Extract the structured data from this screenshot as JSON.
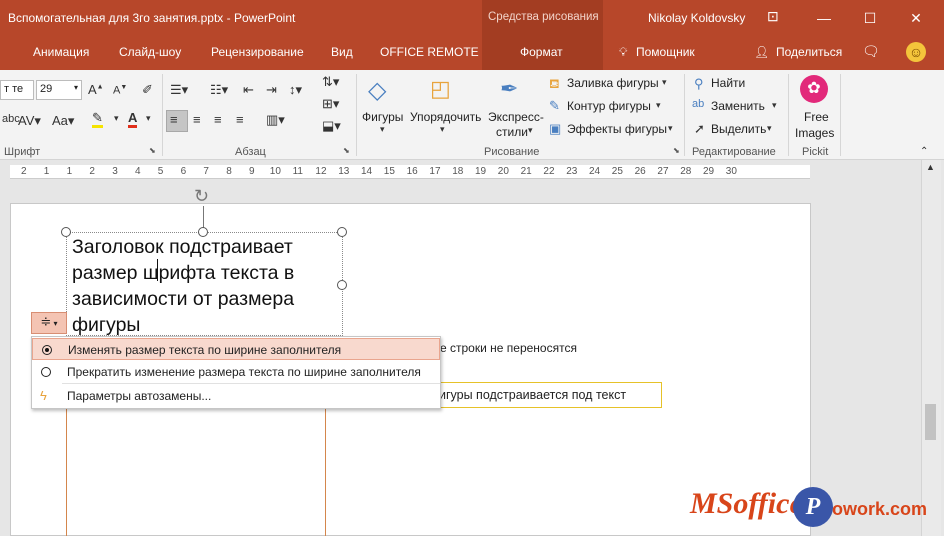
{
  "titlebar": {
    "document_title": "Вспомогательная для 3го занятия.pptx  -  PowerPoint",
    "context_group": "Средства рисования",
    "user": "Nikolay Koldovsky",
    "min_glyph": "—",
    "max_glyph": "☐",
    "close_glyph": "✕"
  },
  "tabs": {
    "animation": "Анимация",
    "slideshow": "Слайд-шоу",
    "review": "Рецензирование",
    "view": "Вид",
    "office_remote": "OFFICE REMOTE",
    "format": "Формат",
    "help": "Помощник",
    "share": "Поделиться"
  },
  "ribbon": {
    "font_name": "т те",
    "font_size": "29",
    "groups": {
      "font": "Шрифт",
      "paragraph": "Абзац",
      "drawing": "Рисование",
      "editing": "Редактирование",
      "pickit": "Pickit"
    },
    "shapes": "Фигуры",
    "arrange": "Упорядочить",
    "quick_styles_1": "Экспресс-",
    "quick_styles_2": "стили",
    "shape_fill": "Заливка фигуры",
    "shape_outline": "Контур фигуры",
    "shape_effects": "Эффекты фигуры",
    "find": "Найти",
    "replace": "Заменить",
    "select": "Выделить",
    "free_images_1": "Free",
    "free_images_2": "Images",
    "colors": {
      "accent": "#b7472a",
      "highlight": "#f5e400",
      "font_red": "#e12f1a"
    }
  },
  "ruler": {
    "labels": [
      "2",
      "1",
      "1",
      "2",
      "3",
      "4",
      "5",
      "6",
      "7",
      "8",
      "9",
      "10",
      "11",
      "12",
      "13",
      "14",
      "15",
      "16",
      "17",
      "18",
      "19",
      "20",
      "21",
      "22",
      "23",
      "24",
      "25",
      "26",
      "27",
      "28",
      "29",
      "30"
    ]
  },
  "slide": {
    "textbox_text": "Заголовок подстраивает размер шрифта текста в зависимости от размера фигуры",
    "text_behind_1": "е строки не переносятся",
    "text_behind_2": "игуры подстраивается под текст"
  },
  "autofit_menu": {
    "items": [
      {
        "label": "Изменять размер текста по ширине заполнителя",
        "selected": true
      },
      {
        "label": "Прекратить изменение размера текста по ширине заполнителя",
        "selected": false
      },
      {
        "label": "Параметры автозамены...",
        "icon": "lightning-icon"
      }
    ]
  },
  "watermark": {
    "part1": "MSoffice",
    "p": "P",
    "part2": "owork.com"
  }
}
